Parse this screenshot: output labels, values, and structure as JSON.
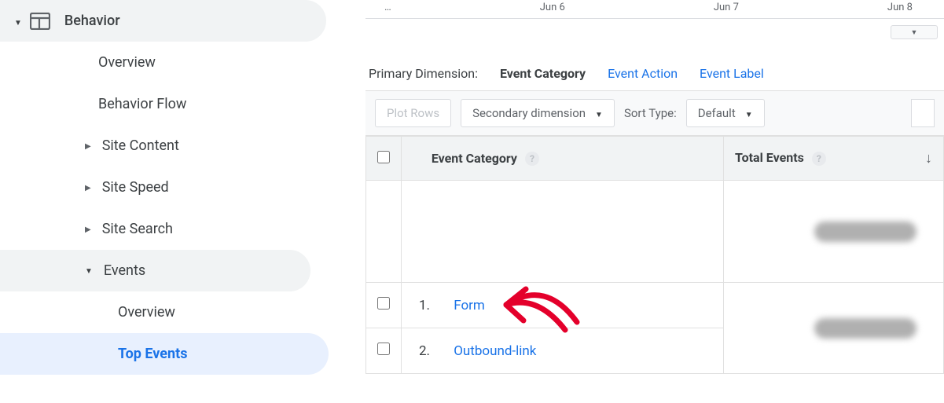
{
  "sidebar": {
    "section_label": "Behavior",
    "overview": "Overview",
    "behavior_flow": "Behavior Flow",
    "site_content": "Site Content",
    "site_speed": "Site Speed",
    "site_search": "Site Search",
    "events": "Events",
    "events_overview": "Overview",
    "top_events": "Top Events"
  },
  "date_axis": {
    "start": "…",
    "d1": "Jun 6",
    "d2": "Jun 7",
    "d3": "Jun 8"
  },
  "primary_dimension": {
    "label": "Primary Dimension:",
    "active": "Event Category",
    "opt1": "Event Action",
    "opt2": "Event Label"
  },
  "toolbar": {
    "plot_rows": "Plot Rows",
    "secondary_dim": "Secondary dimension",
    "sort_type_label": "Sort Type:",
    "sort_default": "Default"
  },
  "table": {
    "col_event_category": "Event Category",
    "col_total_events": "Total Events",
    "rows": [
      {
        "n": "1.",
        "name": "Form"
      },
      {
        "n": "2.",
        "name": "Outbound-link"
      }
    ]
  }
}
